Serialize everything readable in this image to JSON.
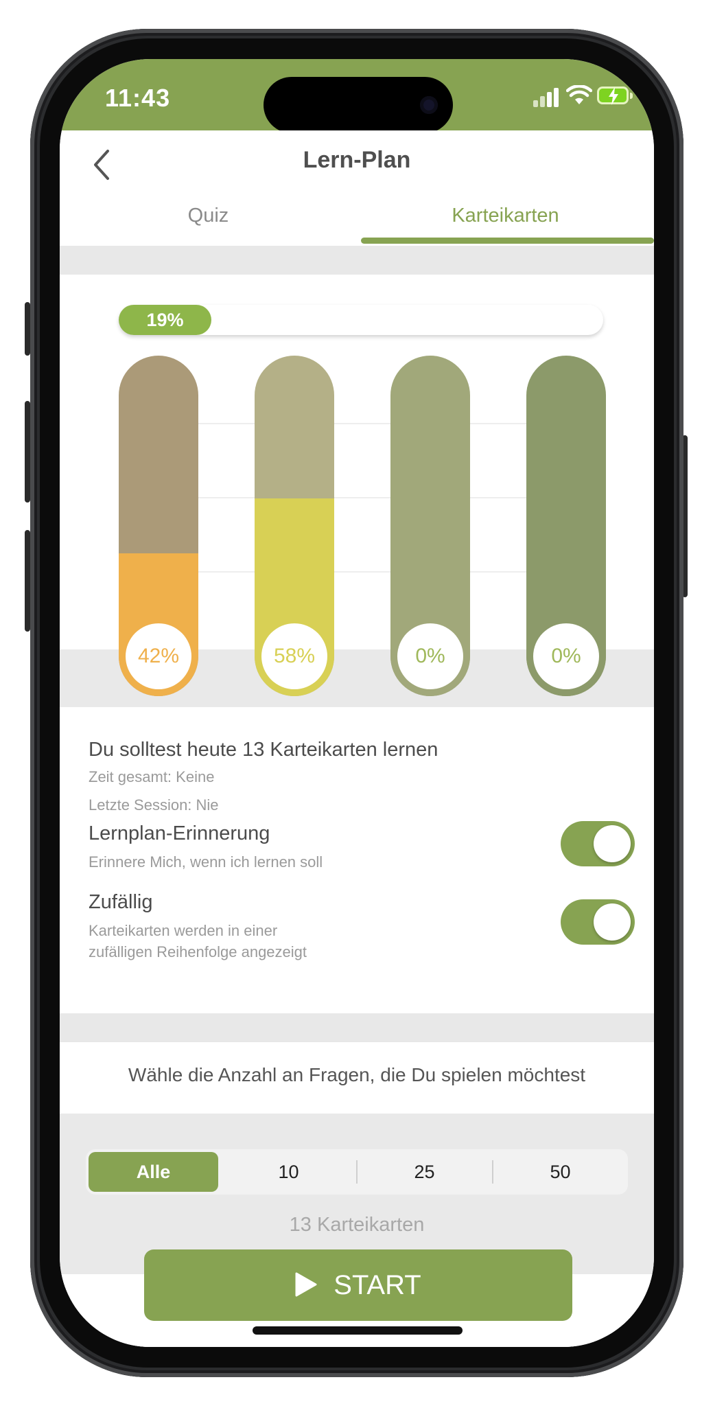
{
  "status_bar": {
    "time": "11:43"
  },
  "nav": {
    "title": "Lern-Plan",
    "back_icon": "chevron-left-icon"
  },
  "tabs": [
    {
      "label": "Quiz",
      "active": false
    },
    {
      "label": "Karteikarten",
      "active": true
    }
  ],
  "progress": {
    "label": "19%",
    "value": 0.19
  },
  "bars": [
    {
      "label": "42%",
      "value": 0.42,
      "track": "#ab9a78",
      "fill": "#efb04b",
      "text": "#efb04b"
    },
    {
      "label": "58%",
      "value": 0.58,
      "track": "#b4b087",
      "fill": "#d8d055",
      "text": "#d8d055"
    },
    {
      "label": "0%",
      "value": 0,
      "track": "#a1a87a",
      "fill": "#a1a87a",
      "text": "#9fb85a"
    },
    {
      "label": "0%",
      "value": 0,
      "track": "#8c9a6a",
      "fill": "#8c9a6a",
      "text": "#9fb85a"
    }
  ],
  "info": {
    "headline": "Du solltest heute 13 Karteikarten lernen",
    "time_total": "Zeit gesamt: Keine",
    "last_session": "Letzte Session: Nie",
    "reminder": {
      "title": "Lernplan-Erinnerung",
      "subtitle": "Erinnere Mich, wenn ich lernen soll",
      "on": true
    },
    "random": {
      "title": "Zufällig",
      "subtitle_line1": "Karteikarten werden in einer",
      "subtitle_line2": "zufälligen Reihenfolge angezeigt",
      "on": true
    }
  },
  "question_prompt": "Wähle die Anzahl an Fragen, die Du spielen möchtest",
  "segment": {
    "options": [
      "Alle",
      "10",
      "25",
      "50"
    ],
    "selected": "Alle"
  },
  "card_count": "13 Karteikarten",
  "start_label": "START",
  "colors": {
    "accent": "#87a352",
    "progress": "#8eb64a"
  }
}
